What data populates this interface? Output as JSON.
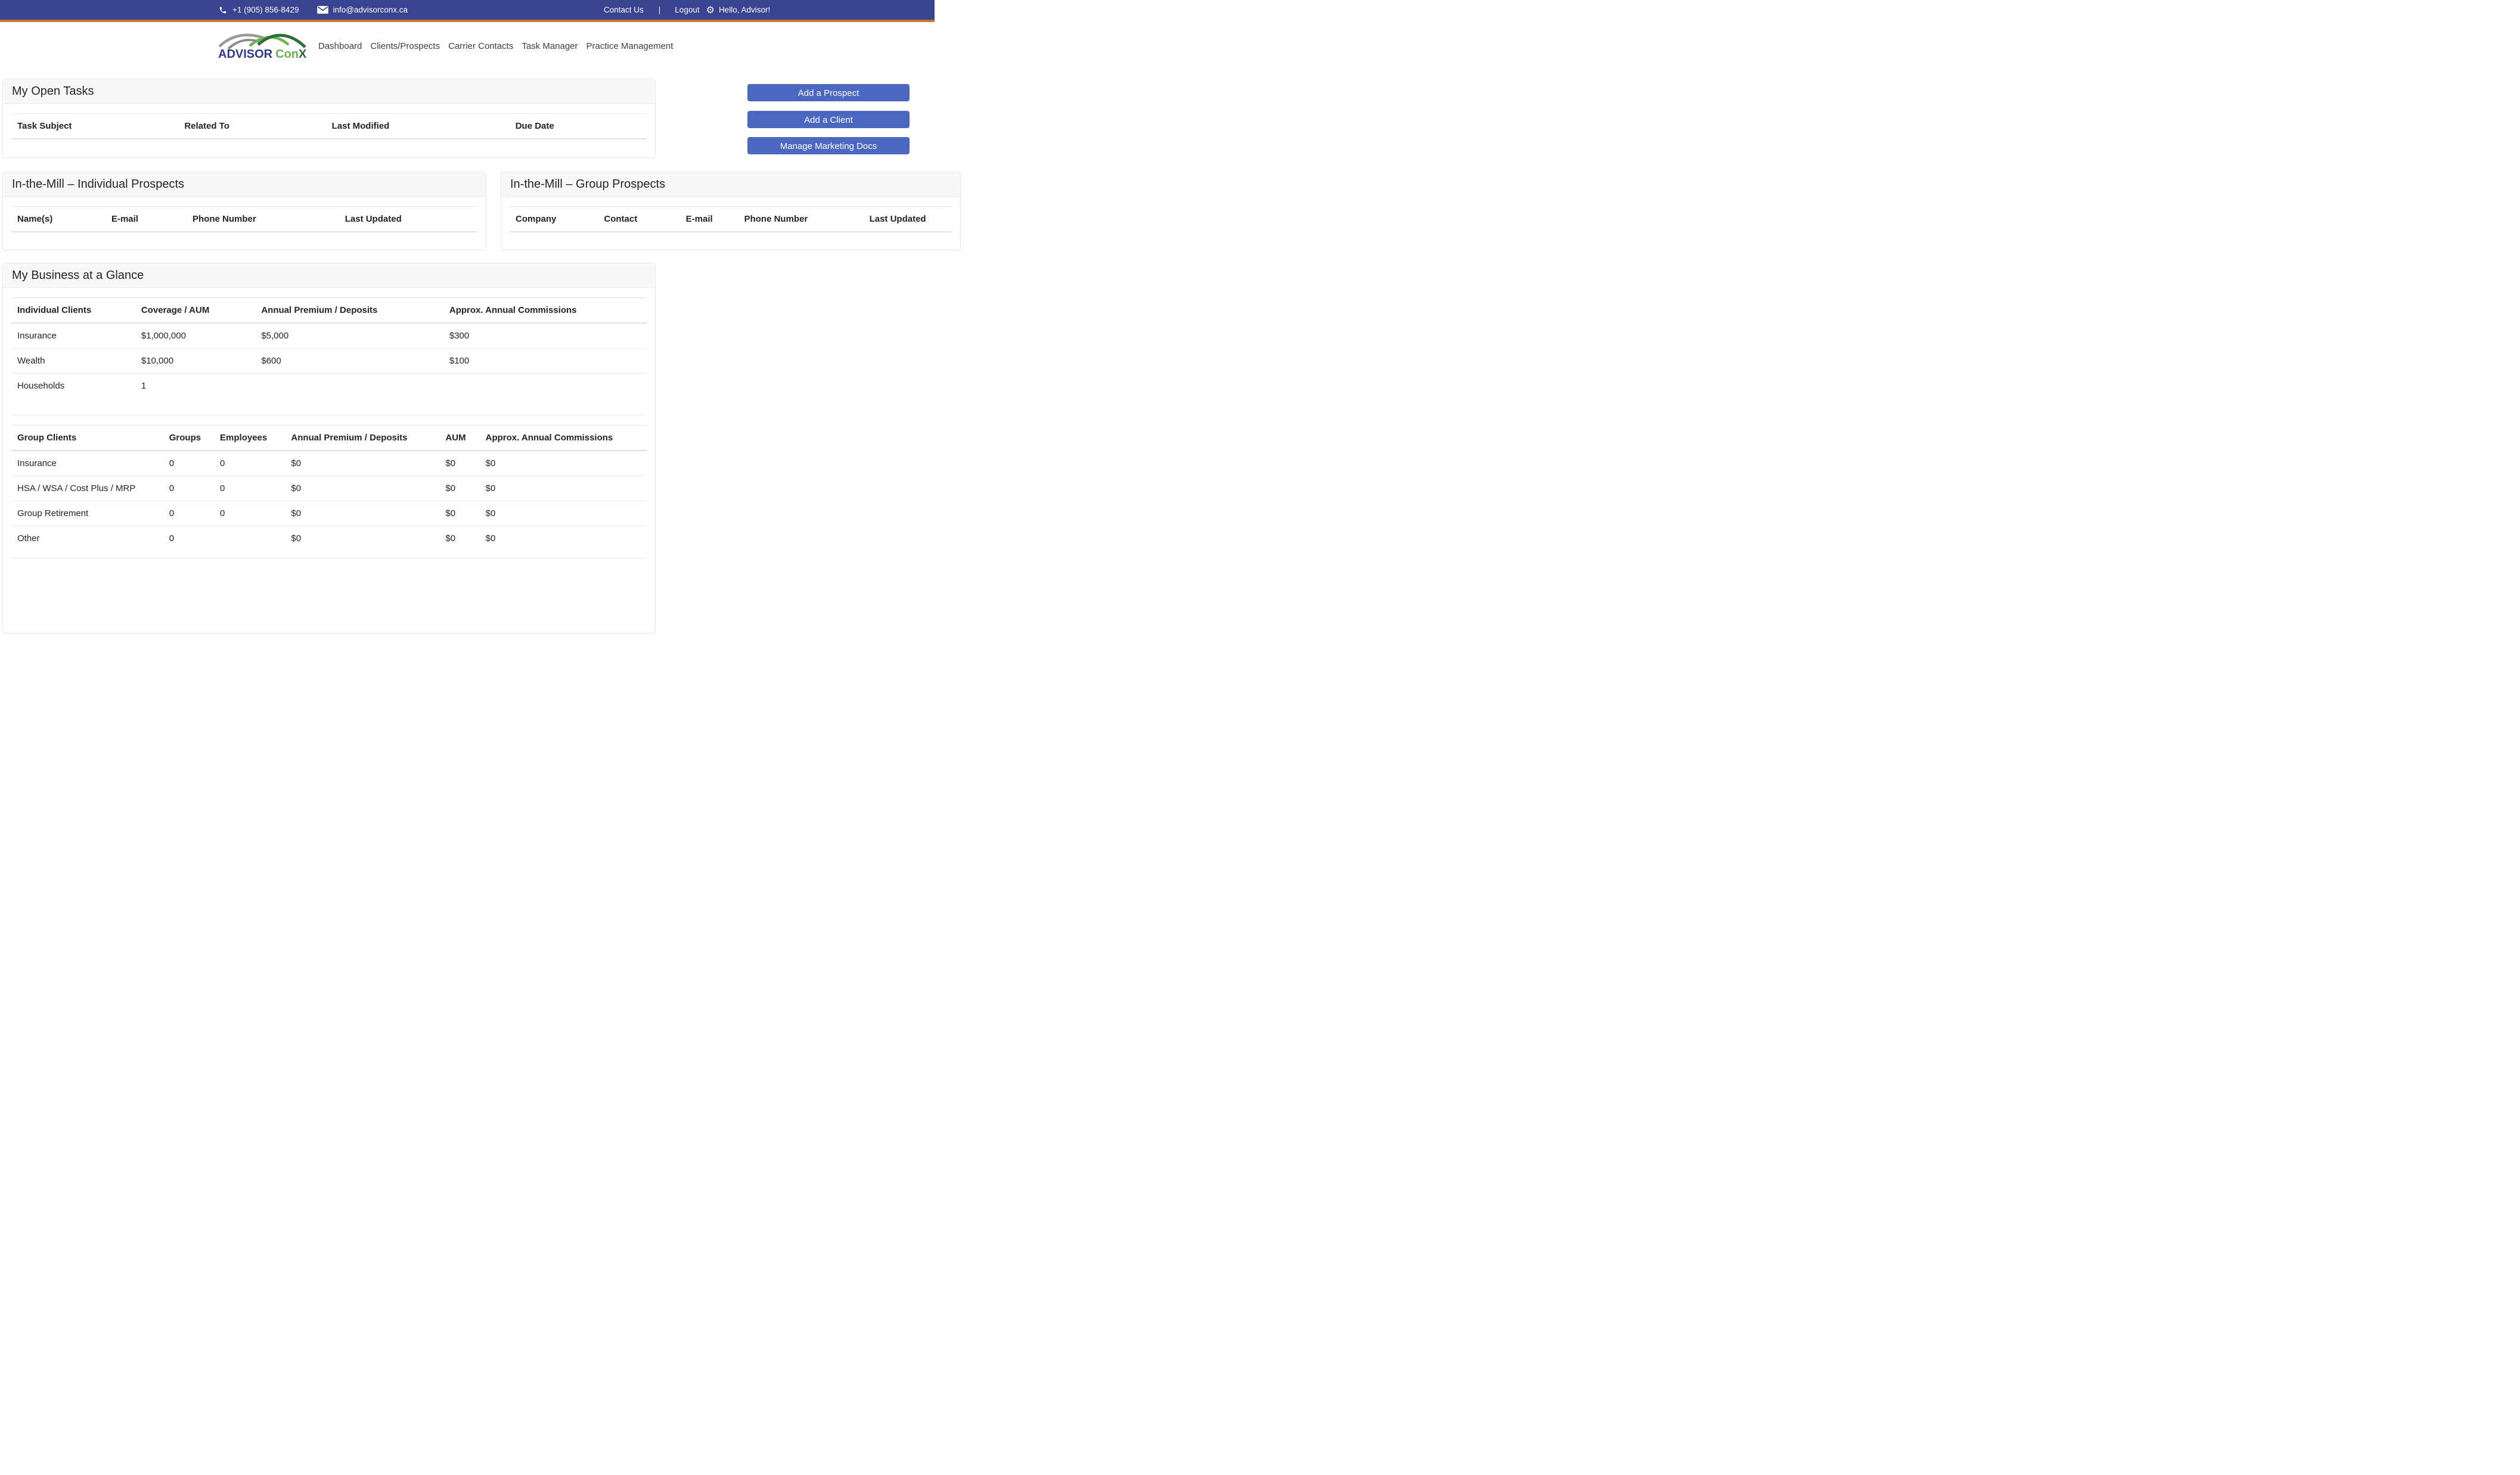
{
  "topbar": {
    "phone": "+1 (905) 856-8429",
    "email": "info@advisorconx.ca",
    "contact_us": "Contact Us",
    "separator": "|",
    "logout": "Logout",
    "greeting": "Hello, Advisor!"
  },
  "brand": {
    "name_primary": "ADVISOR",
    "name_secondary_1": "Con",
    "name_secondary_2": "X"
  },
  "nav": {
    "items": [
      {
        "label": "Dashboard"
      },
      {
        "label": "Clients/Prospects"
      },
      {
        "label": "Carrier Contacts"
      },
      {
        "label": "Task Manager"
      },
      {
        "label": "Practice Management"
      }
    ]
  },
  "actions": {
    "buttons": [
      {
        "label": "Add a Prospect"
      },
      {
        "label": "Add a Client"
      },
      {
        "label": "Manage Marketing Docs"
      }
    ]
  },
  "open_tasks": {
    "title": "My Open Tasks",
    "columns": [
      "Task Subject",
      "Related To",
      "Last Modified",
      "Due Date"
    ],
    "rows": []
  },
  "individual_prospects": {
    "title": "In-the-Mill – Individual Prospects",
    "columns": [
      "Name(s)",
      "E-mail",
      "Phone Number",
      "Last Updated"
    ],
    "rows": []
  },
  "group_prospects": {
    "title": "In-the-Mill – Group Prospects",
    "columns": [
      "Company",
      "Contact",
      "E-mail",
      "Phone Number",
      "Last Updated"
    ],
    "rows": []
  },
  "business_glance": {
    "title": "My Business at a Glance",
    "individual_table": {
      "columns": [
        "Individual Clients",
        "Coverage / AUM",
        "Annual Premium / Deposits",
        "Approx. Annual Commissions"
      ],
      "rows": [
        [
          "Insurance",
          "$1,000,000",
          "$5,000",
          "$300"
        ],
        [
          "Wealth",
          "$10,000",
          "$600",
          "$100"
        ],
        [
          "Households",
          "1",
          "",
          ""
        ]
      ]
    },
    "group_table": {
      "columns": [
        "Group Clients",
        "Groups",
        "Employees",
        "Annual Premium / Deposits",
        "AUM",
        "Approx. Annual Commissions"
      ],
      "rows": [
        [
          "Insurance",
          "0",
          "0",
          "$0",
          "$0",
          "$0"
        ],
        [
          "HSA / WSA / Cost Plus / MRP",
          "0",
          "0",
          "$0",
          "$0",
          "$0"
        ],
        [
          "Group Retirement",
          "0",
          "0",
          "$0",
          "$0",
          "$0"
        ],
        [
          "Other",
          "0",
          "",
          "$0",
          "$0",
          "$0"
        ]
      ]
    }
  },
  "colors": {
    "topbar_blue": "#3a4391",
    "accent_orange": "#cf7538",
    "button_blue": "#4b67c1",
    "logo_navy": "#2c3a8c",
    "logo_green_light": "#6cb052",
    "logo_green_dark": "#276a34"
  }
}
